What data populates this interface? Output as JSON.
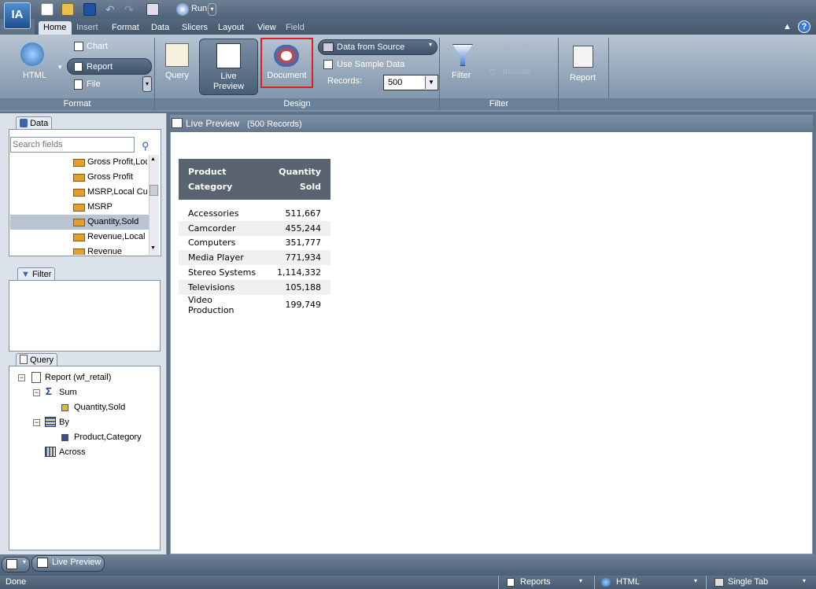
{
  "menu": {
    "tabs": [
      "Home",
      "Insert",
      "Format",
      "Data",
      "Slicers",
      "Layout",
      "View",
      "Field"
    ],
    "active": "Home"
  },
  "quick_access": {
    "run_label": "Run"
  },
  "ribbon": {
    "format": {
      "html_label": "HTML",
      "chart_label": "Chart",
      "report_label": "Report",
      "file_label": "File",
      "group_label": "Format"
    },
    "design": {
      "query_label": "Query",
      "live_preview_label": "Live\nPreview",
      "document_label": "Document",
      "data_source_label": "Data from Source",
      "sample_data_label": "Use Sample Data",
      "records_label": "Records:",
      "records_value": "500",
      "group_label": "Design"
    },
    "filter": {
      "filter_label": "Filter",
      "exclude_label": "Exclude",
      "include_label": "Include",
      "group_label": "Filter"
    },
    "report": {
      "report_label": "Report"
    }
  },
  "data_panel": {
    "title": "Data",
    "search_placeholder": "Search fields",
    "fields": [
      "Gross Profit,Local",
      "Gross Profit",
      "MSRP,Local Currency",
      "MSRP",
      "Quantity,Sold",
      "Revenue,Local",
      "Revenue"
    ],
    "selected_field": "Quantity,Sold"
  },
  "filter_panel": {
    "title": "Filter"
  },
  "query_panel": {
    "title": "Query",
    "report": "Report (wf_retail)",
    "sum": "Sum",
    "sum_field": "Quantity,Sold",
    "by": "By",
    "by_field": "Product,Category",
    "across": "Across"
  },
  "preview": {
    "title": "Live Preview",
    "records": "(500 Records)",
    "table": {
      "headers": [
        "Product\nCategory",
        "Quantity\nSold"
      ],
      "rows": [
        [
          "Accessories",
          "511,667"
        ],
        [
          "Camcorder",
          "455,244"
        ],
        [
          "Computers",
          "351,777"
        ],
        [
          "Media Player",
          "771,934"
        ],
        [
          "Stereo Systems",
          "1,114,332"
        ],
        [
          "Televisions",
          "105,188"
        ],
        [
          "Video Production",
          "199,749"
        ]
      ]
    }
  },
  "bottom_tab": {
    "label": "Live Preview"
  },
  "status": {
    "text": "Done",
    "reports": "Reports",
    "format": "HTML",
    "tab_mode": "Single Tab"
  },
  "colors": {
    "highlight_border": "#e02020",
    "header_bg": "#5a6370",
    "selected_row": "#b8c4d2"
  }
}
